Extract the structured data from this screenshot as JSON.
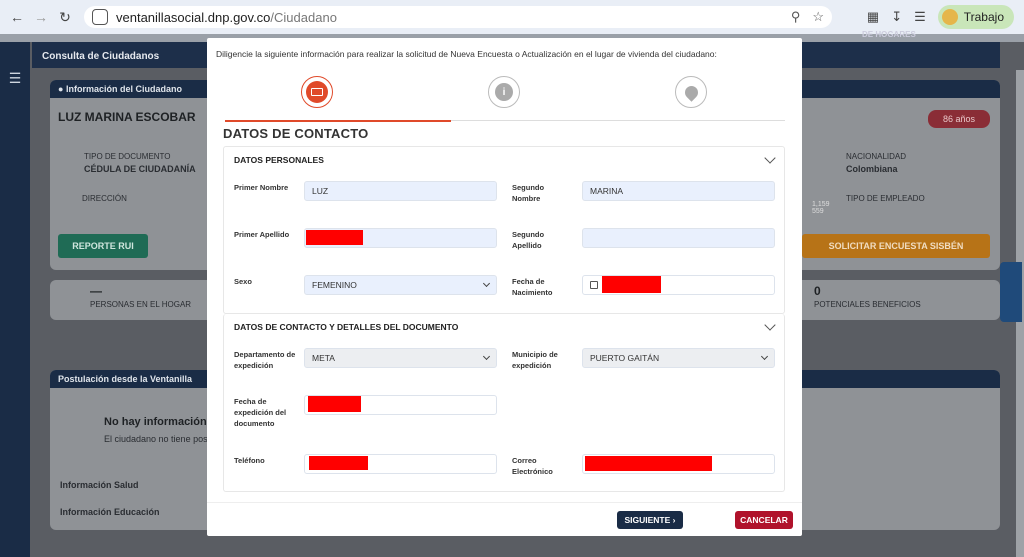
{
  "browser": {
    "url_host": "ventanillasocial.dnp.gov.co",
    "url_path": "/Ciudadano",
    "profile_label": "Trabajo"
  },
  "background": {
    "subnav": "Consulta de Ciudadanos",
    "citizen_card_title": "Información del Ciudadano",
    "citizen_name": "LUZ MARINA ESCOBAR",
    "age_badge": "86 años",
    "doc_type_label": "TIPO DE DOCUMENTO",
    "doc_type_value": "CÉDULA DE CIUDADANÍA",
    "address_label": "DIRECCIÓN",
    "nationality_label": "NACIONALIDAD",
    "nationality_value": "Colombiana",
    "employee_type_label": "TIPO DE EMPLEADO",
    "report_button": "REPORTE RUI",
    "sisben_button": "SOLICITAR ENCUESTA SISBÉN",
    "household_count": "—",
    "household_label": "PERSONAS EN EL HOGAR",
    "benefits_count": "0",
    "benefits_label": "POTENCIALES BENEFICIOS",
    "postulation_title": "Postulación desde la Ventanilla",
    "no_info_title": "No hay información re",
    "no_info_text": "El ciudadano no tiene postu",
    "health_section": "Información Salud",
    "education_section": "Información Educación",
    "hogares_text": "DE HOGARES",
    "cursor_readout_1": "1,159",
    "cursor_readout_2": "559"
  },
  "modal": {
    "intro": "Diligencie la siguiente información para realizar la solicitud de Nueva Encuesta o Actualización en el lugar de vivienda del ciudadano:",
    "title": "DATOS DE CONTACTO",
    "sections": {
      "personal": {
        "heading": "DATOS PERSONALES",
        "first_name_label": "Primer Nombre",
        "first_name_value": "LUZ",
        "second_name_label": "Segundo Nombre",
        "second_name_value": "MARINA",
        "first_surname_label": "Primer Apellido",
        "second_surname_label": "Segundo Apellido",
        "sex_label": "Sexo",
        "sex_value": "FEMENINO",
        "birth_date_label": "Fecha de Nacimiento"
      },
      "contact": {
        "heading": "DATOS DE CONTACTO Y DETALLES DEL DOCUMENTO",
        "department_label": "Departamento de expedición",
        "department_value": "META",
        "municipality_label": "Municipio de expedición",
        "municipality_value": "PUERTO GAITÁN",
        "issue_date_label": "Fecha de expedición del documento",
        "phone_label": "Teléfono",
        "email_label": "Correo Electrónico"
      }
    },
    "next_button": "SIGUIENTE",
    "cancel_button": "CANCELAR"
  },
  "colors": {
    "accent_red": "#e04a2a",
    "navy": "#1a2c46",
    "cancel": "#b0122b",
    "field_bg": "#e9f0fd",
    "redaction": "#ff0000"
  }
}
